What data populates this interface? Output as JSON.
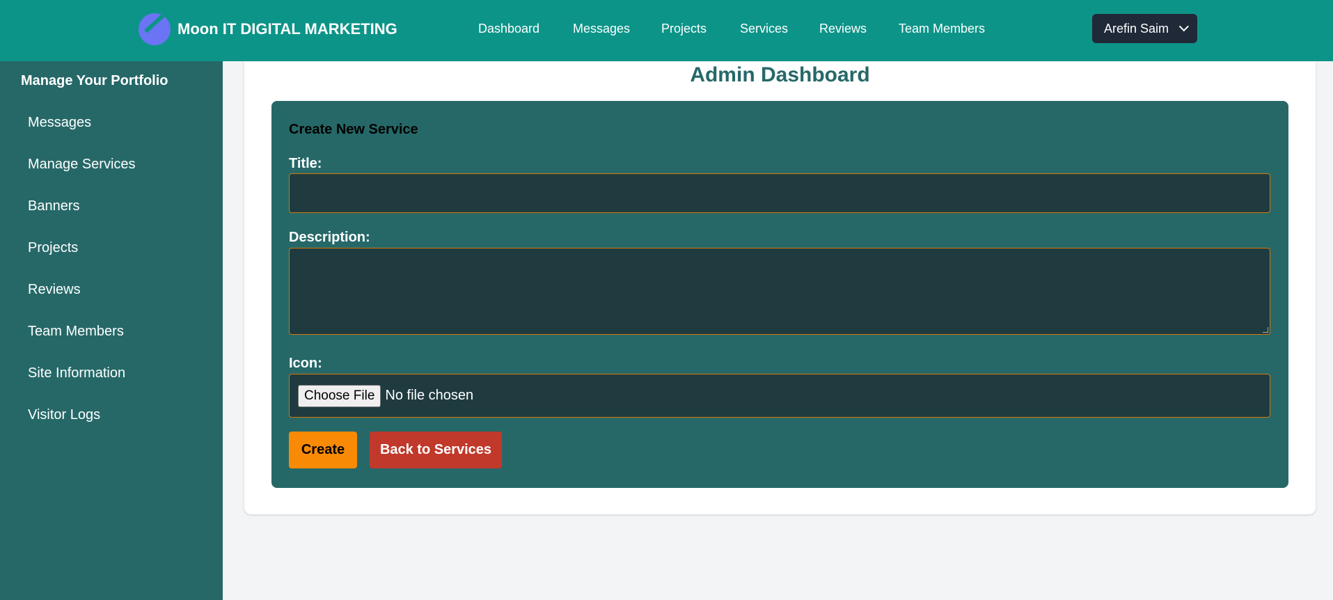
{
  "brand": {
    "name": "Moon IT DIGITAL MARKETING",
    "logo_icon": "moon-logo-icon"
  },
  "nav": {
    "items": [
      {
        "label": "Dashboard"
      },
      {
        "label": "Messages"
      },
      {
        "label": "Projects"
      },
      {
        "label": "Services"
      },
      {
        "label": "Reviews"
      },
      {
        "label": "Team Members"
      }
    ]
  },
  "user": {
    "name": "Arefin Saim",
    "icon": "chevron-down-icon"
  },
  "sidebar": {
    "title": "Manage Your Portfolio",
    "items": [
      {
        "label": "Messages"
      },
      {
        "label": "Manage Services"
      },
      {
        "label": "Banners"
      },
      {
        "label": "Projects"
      },
      {
        "label": "Reviews"
      },
      {
        "label": "Team Members"
      },
      {
        "label": "Site Information"
      },
      {
        "label": "Visitor Logs"
      }
    ]
  },
  "main": {
    "title": "Admin Dashboard",
    "form": {
      "heading": "Create New Service",
      "title_label": "Title:",
      "title_value": "",
      "description_label": "Description:",
      "description_value": "",
      "icon_label": "Icon:",
      "file_button": "Choose File",
      "file_status": "No file chosen",
      "create_label": "Create",
      "back_label": "Back to Services"
    }
  },
  "colors": {
    "topbar": "#0d9488",
    "sidebar": "#266868",
    "accent_orange": "#f98a05",
    "danger_red": "#c0392b",
    "input_bg": "#1f3b40"
  }
}
